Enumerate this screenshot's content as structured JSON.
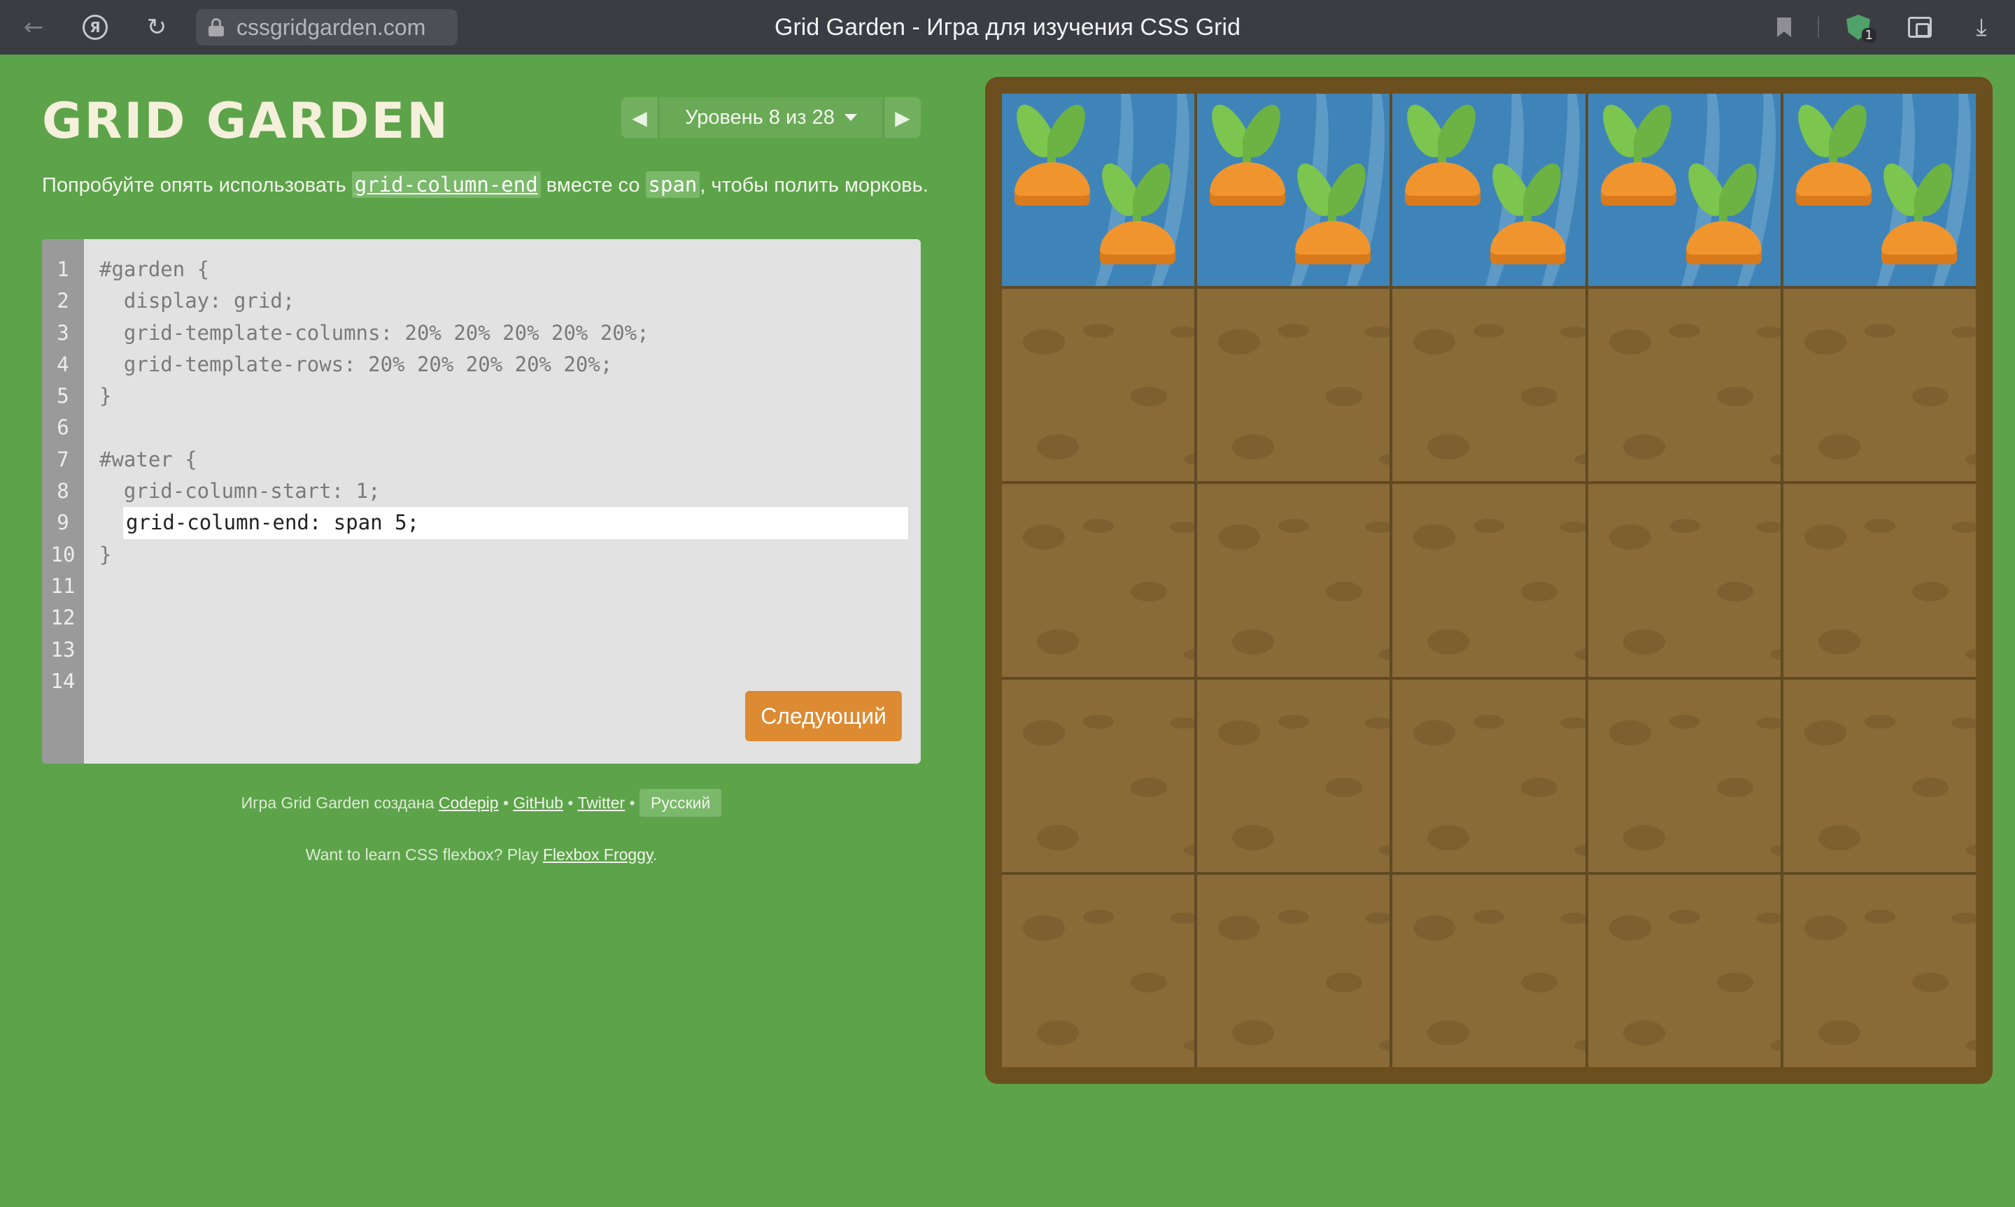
{
  "browser": {
    "url": "cssgridgarden.com",
    "title": "Grid Garden - Игра для изучения CSS Grid",
    "shield_badge": "1"
  },
  "header": {
    "game_title": "GRID GARDEN",
    "level_label": "Уровень 8 из 28"
  },
  "instruction": {
    "part1": "Попробуйте опять использовать ",
    "keyword1": "grid-column-end",
    "part2": " вместе со ",
    "keyword2": "span",
    "part3": ", чтобы полить морковь."
  },
  "editor": {
    "line_numbers": [
      "1",
      "2",
      "3",
      "4",
      "5",
      "6",
      "7",
      "8",
      "9",
      "10",
      "11",
      "12",
      "13",
      "14"
    ],
    "lines": [
      "#garden {",
      "  display: grid;",
      "  grid-template-columns: 20% 20% 20% 20% 20%;",
      "  grid-template-rows: 20% 20% 20% 20% 20%;",
      "}",
      "",
      "#water {",
      "  grid-column-start: 1;"
    ],
    "input_value": "grid-column-end: span 5;",
    "closing_lines": [
      "}",
      "",
      "",
      "",
      ""
    ],
    "next_button": "Следующий"
  },
  "footer": {
    "credit_prefix": "Игра Grid Garden создана",
    "link_codepip": "Codepip",
    "link_github": "GitHub",
    "link_twitter": "Twitter",
    "bullet": "•",
    "language": "Русский",
    "flexbox_prefix": "Want to learn CSS flexbox? Play",
    "link_froggy": "Flexbox Froggy",
    "flexbox_suffix": "."
  },
  "garden": {
    "columns": 5,
    "rows": 5,
    "water_row": 1,
    "water_span": 5
  },
  "colors": {
    "page_bg": "#5da34a",
    "next_button": "#dd8b32",
    "water": "#3f84b8",
    "soil": "#8a6a36",
    "carrot": "#f0952e"
  }
}
